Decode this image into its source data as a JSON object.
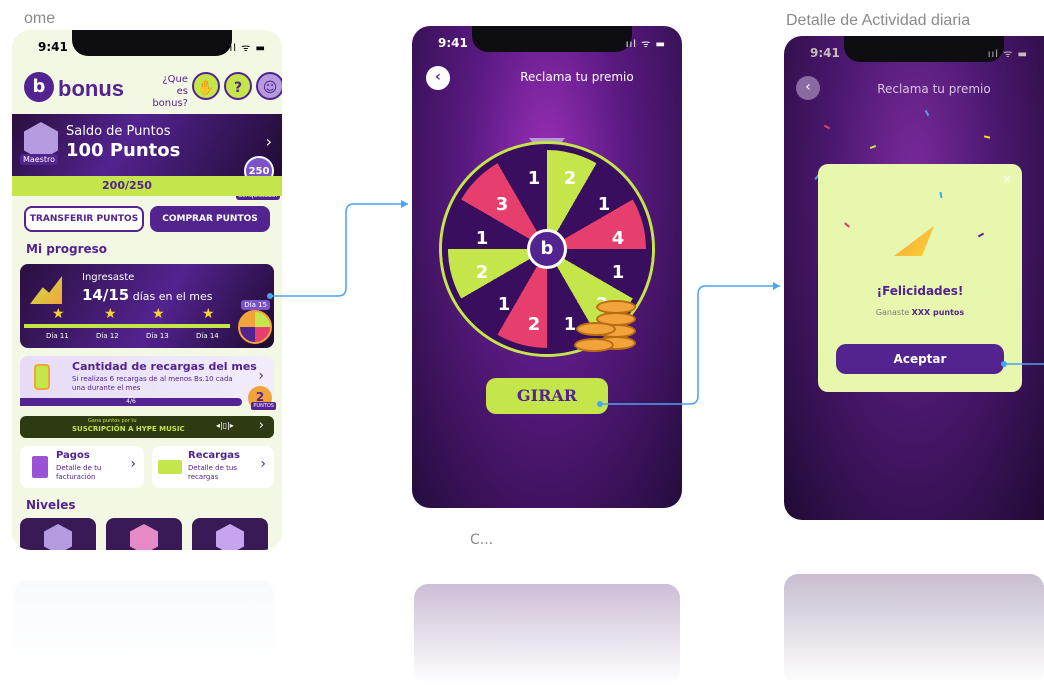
{
  "frames": {
    "home_title": "ome",
    "detail_title": "Detalle de Actividad diaria",
    "caption_c": "C..."
  },
  "status": {
    "time": "9:41",
    "signal": "ııl ᯤ ▬"
  },
  "home": {
    "brand": "bonus",
    "logo_letter": "b",
    "que_es": "¿Que es bonus?",
    "points_card": {
      "saldo_label": "Saldo de Puntos",
      "points_value": "100 Puntos",
      "level_badge": "Maestro",
      "progress_text": "200/250",
      "next_level_points": "250",
      "next_level_label": "Conquistador"
    },
    "buttons": {
      "transfer": "TRANSFERIR PUNTOS",
      "buy": "COMPRAR PUNTOS"
    },
    "progress_title": "Mi progreso",
    "progress_card": {
      "ingresaste": "Ingresaste",
      "days_count": "14/15",
      "days_suffix": " días en el mes",
      "days": [
        "Día 11",
        "Día 12",
        "Día 13",
        "Día 14"
      ],
      "day15": "Día 15"
    },
    "recargas_card": {
      "title": "Cantidad de recargas del mes",
      "desc": "Si realizas 6 recargas de al menos Bs.10 cada una durante el mes",
      "progress": "4/6",
      "points": "2",
      "points_label": "PUNTOS"
    },
    "music_banner": {
      "small": "Gana puntos por tu",
      "big": "SUSCRIPCIÓN A HYPE MUSIC",
      "wave": "◂|▯|▸"
    },
    "pagos": {
      "title": "Pagos",
      "desc": "Detalle de tu facturación"
    },
    "recargas": {
      "title": "Recargas",
      "desc": "Detalle de tus recargas"
    },
    "niveles_title": "Niveles"
  },
  "roulette": {
    "title": "Reclama tu premio",
    "numbers": [
      "2",
      "1",
      "4",
      "1",
      "2",
      "1",
      "2",
      "1",
      "2",
      "1",
      "3",
      "1"
    ],
    "center": "b",
    "spin_label": "GIRAR"
  },
  "result": {
    "title": "Reclama tu premio",
    "congrats": "¡Felicidades!",
    "won_prefix": "Ganaste ",
    "won_points": "XXX puntos",
    "accept_label": "Aceptar",
    "close": "×"
  },
  "colors": {
    "primary": "#53238f",
    "accent": "#c4e64a",
    "pink": "#e63e6d",
    "orange": "#f2a33a",
    "connector": "#4aa3f0"
  },
  "icons": {
    "back": "chevron-left-icon",
    "next": "chevron-right-icon",
    "help": "question-icon",
    "hand": "hand-icon",
    "avatar": "avatar-icon",
    "star": "star-icon",
    "party": "party-popper-icon"
  }
}
